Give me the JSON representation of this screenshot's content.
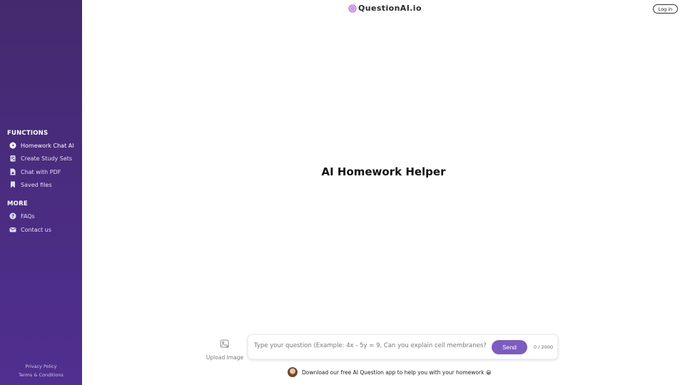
{
  "app": {
    "logo_text": "QuestionAI.io",
    "login_label": "Log in"
  },
  "colors": {
    "sidebar_top": "#45296d",
    "sidebar_bottom": "#502f90",
    "accent": "#7d5cc0"
  },
  "sidebar": {
    "functions_title": "FUNCTIONS",
    "functions": [
      {
        "label": "Homework Chat AI",
        "icon": "chat-bubble-icon",
        "active": true
      },
      {
        "label": "Create Study Sets",
        "icon": "study-sets-icon",
        "active": false
      },
      {
        "label": "Chat with PDF",
        "icon": "pdf-file-icon",
        "active": false
      },
      {
        "label": "Saved files",
        "icon": "bookmark-icon",
        "active": false
      }
    ],
    "more_title": "MORE",
    "more": [
      {
        "label": "FAQs",
        "icon": "question-circle-icon"
      },
      {
        "label": "Contact us",
        "icon": "envelope-icon"
      }
    ],
    "footer": {
      "privacy": "Privacy Policy",
      "terms": "Terms & Conditions"
    }
  },
  "main": {
    "headline": "AI Homework Helper",
    "upload_label": "Upload Image",
    "input": {
      "value": "",
      "placeholder": "Type your question (Example: 4x - 5y = 9, Can you explain cell membranes?)"
    },
    "send_label": "Send",
    "char_counter": "0 / 2000",
    "promo_text": "Download our free AI Question app to help you with your homework 😀"
  }
}
